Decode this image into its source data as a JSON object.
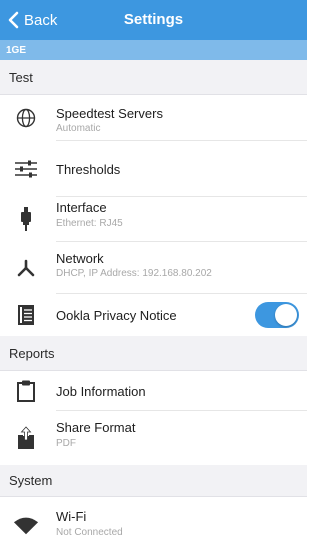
{
  "navbar": {
    "back_label": "Back",
    "title": "Settings",
    "background": "#3d97e0"
  },
  "device_bar": {
    "label": "1GE",
    "background": "#7fbaea"
  },
  "sections": {
    "test": "Test",
    "reports": "Reports",
    "system": "System"
  },
  "test_items": [
    {
      "icon": "globe-icon",
      "title": "Speedtest Servers",
      "subtitle": "Automatic"
    },
    {
      "icon": "sliders-icon",
      "title": "Thresholds"
    },
    {
      "icon": "ethernet-plug-icon",
      "title": "Interface",
      "subtitle": "Ethernet: RJ45"
    },
    {
      "icon": "network-nodes-icon",
      "title": "Network",
      "subtitle": "DHCP, IP Address: 192.168.80.202"
    },
    {
      "icon": "document-icon",
      "title": "Ookla Privacy Notice",
      "toggle_on": true
    }
  ],
  "report_items": [
    {
      "icon": "clipboard-icon",
      "title": "Job Information"
    },
    {
      "icon": "share-icon",
      "title": "Share Format",
      "subtitle": "PDF"
    }
  ],
  "system_items": [
    {
      "icon": "wifi-icon",
      "title": "Wi-Fi",
      "subtitle": "Not Connected"
    }
  ],
  "colors": {
    "accent": "#3d97e0",
    "section_bg": "#f2f2f5",
    "subtitle": "#a8a8a8"
  }
}
